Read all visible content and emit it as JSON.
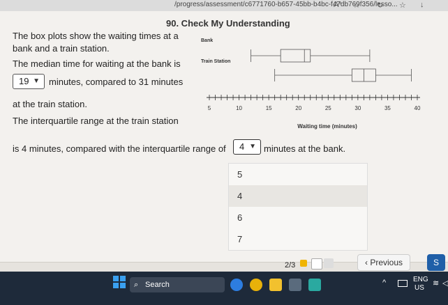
{
  "browser": {
    "url": "/progress/assessment/c6771760-b657-45bb-b4bc-f47db769f356/lesso...",
    "icons": [
      "read-aloud-icon",
      "favorite-star-icon",
      "refresh-icon",
      "collections-icon",
      "download-icon"
    ]
  },
  "question": {
    "title": "90. Check My Understanding",
    "line1": "The box plots show the waiting times at a",
    "line2": "bank and a train station.",
    "line3": "The median time for waiting at the bank is",
    "dd1_value": "19",
    "line4": "minutes, compared to 31 minutes",
    "line5": "at the train station.",
    "line6": "The interquartile range at the train station",
    "line7": "is 4 minutes, compared with the interquartile range of",
    "dd2_value": "4",
    "line8": "minutes at the bank.",
    "options": [
      "5",
      "4",
      "6",
      "7"
    ],
    "highlighted_option": "4"
  },
  "chart_data": {
    "type": "boxplot",
    "xlabel": "Waiting time (minutes)",
    "xlim": [
      5,
      40
    ],
    "ticks": [
      5,
      10,
      15,
      20,
      25,
      30,
      35,
      40
    ],
    "series": [
      {
        "name": "Bank",
        "min": 12,
        "q1": 17,
        "median": 21,
        "q3": 22,
        "max": 32
      },
      {
        "name": "Train Station",
        "min": 16,
        "q1": 29,
        "median": 31,
        "q3": 33,
        "max": 39
      }
    ]
  },
  "footer": {
    "progress": "2/3",
    "previous_label": "Previous",
    "next_label": "S"
  },
  "taskbar": {
    "search_label": "Search",
    "lang": "ENG",
    "region": "US"
  }
}
